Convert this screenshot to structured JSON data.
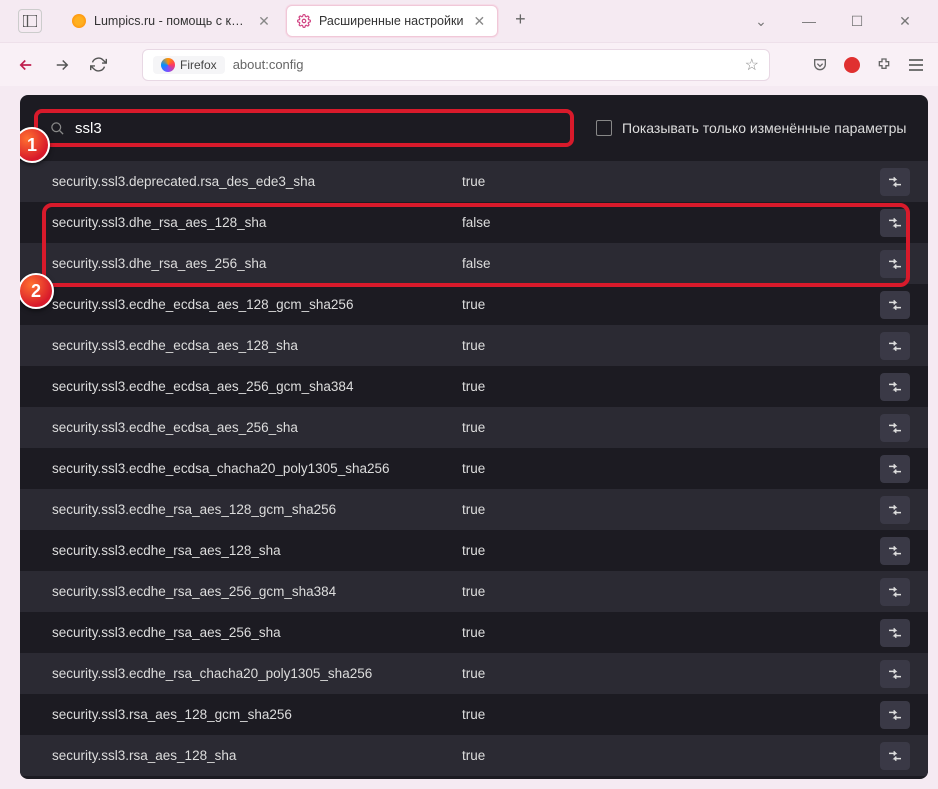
{
  "tabs": [
    {
      "label": "Lumpics.ru - помощь с компь"
    },
    {
      "label": "Расширенные настройки"
    }
  ],
  "urlbar": {
    "badge": "Firefox",
    "url": "about:config"
  },
  "search": {
    "value": "ssl3"
  },
  "checkbox_label": "Показывать только изменённые параметры",
  "prefs": [
    {
      "name": "security.ssl3.deprecated.rsa_des_ede3_sha",
      "value": "true"
    },
    {
      "name": "security.ssl3.dhe_rsa_aes_128_sha",
      "value": "false"
    },
    {
      "name": "security.ssl3.dhe_rsa_aes_256_sha",
      "value": "false"
    },
    {
      "name": "security.ssl3.ecdhe_ecdsa_aes_128_gcm_sha256",
      "value": "true"
    },
    {
      "name": "security.ssl3.ecdhe_ecdsa_aes_128_sha",
      "value": "true"
    },
    {
      "name": "security.ssl3.ecdhe_ecdsa_aes_256_gcm_sha384",
      "value": "true"
    },
    {
      "name": "security.ssl3.ecdhe_ecdsa_aes_256_sha",
      "value": "true"
    },
    {
      "name": "security.ssl3.ecdhe_ecdsa_chacha20_poly1305_sha256",
      "value": "true"
    },
    {
      "name": "security.ssl3.ecdhe_rsa_aes_128_gcm_sha256",
      "value": "true"
    },
    {
      "name": "security.ssl3.ecdhe_rsa_aes_128_sha",
      "value": "true"
    },
    {
      "name": "security.ssl3.ecdhe_rsa_aes_256_gcm_sha384",
      "value": "true"
    },
    {
      "name": "security.ssl3.ecdhe_rsa_aes_256_sha",
      "value": "true"
    },
    {
      "name": "security.ssl3.ecdhe_rsa_chacha20_poly1305_sha256",
      "value": "true"
    },
    {
      "name": "security.ssl3.rsa_aes_128_gcm_sha256",
      "value": "true"
    },
    {
      "name": "security.ssl3.rsa_aes_128_sha",
      "value": "true"
    }
  ],
  "markers": {
    "one": "1",
    "two": "2"
  }
}
